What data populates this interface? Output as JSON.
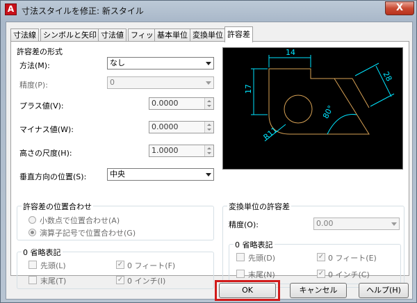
{
  "window": {
    "title": "寸法スタイルを修正: 新スタイル",
    "close_label": "X",
    "icon": "A"
  },
  "tabs": [
    {
      "label": "寸法線"
    },
    {
      "label": "シンボルと矢印"
    },
    {
      "label": "寸法値"
    },
    {
      "label": "フィット"
    },
    {
      "label": "基本単位"
    },
    {
      "label": "変換単位"
    },
    {
      "label": "許容差"
    }
  ],
  "tolerance_format": {
    "heading": "許容差の形式",
    "method_label": "方法(M):",
    "method_value": "なし",
    "precision_label": "精度(P):",
    "precision_value": "0",
    "upper_label": "プラス値(V):",
    "upper_value": "0.0000",
    "lower_label": "マイナス値(W):",
    "lower_value": "0.0000",
    "scale_label": "高さの尺度(H):",
    "scale_value": "1.0000",
    "vertical_label": "垂直方向の位置(S):",
    "vertical_value": "中央"
  },
  "alignment": {
    "heading": "許容差の位置合わせ",
    "decimal_label": "小数点で位置合わせ(A)",
    "operator_label": "演算子記号で位置合わせ(G)"
  },
  "zero_suppression": {
    "heading": "0 省略表記",
    "leading_label": "先頭(L)",
    "trailing_label": "末尾(T)",
    "feet_label": "0 フィート(F)",
    "inches_label": "0 インチ(I)"
  },
  "alt_tolerance": {
    "heading": "変換単位の許容差",
    "precision_label": "精度(O):",
    "precision_value": "0.00",
    "zero_heading": "0 省略表記",
    "leading_label": "先頭(D)",
    "trailing_label": "末尾(N)",
    "feet_label": "0 フィート(E)",
    "inches_label": "0 インチ(C)"
  },
  "preview": {
    "dim_top": "14",
    "dim_left": "17",
    "dim_slant": "28",
    "dim_angle": "80°",
    "dim_radius": "R11"
  },
  "buttons": {
    "ok": "OK",
    "cancel": "キャンセル",
    "help": "ヘルプ(H)"
  },
  "colors": {
    "highlight": "#d11a1a",
    "preview_bg": "#000000",
    "dim_cyan": "#00e5ff",
    "geometry": "#d8a255"
  }
}
